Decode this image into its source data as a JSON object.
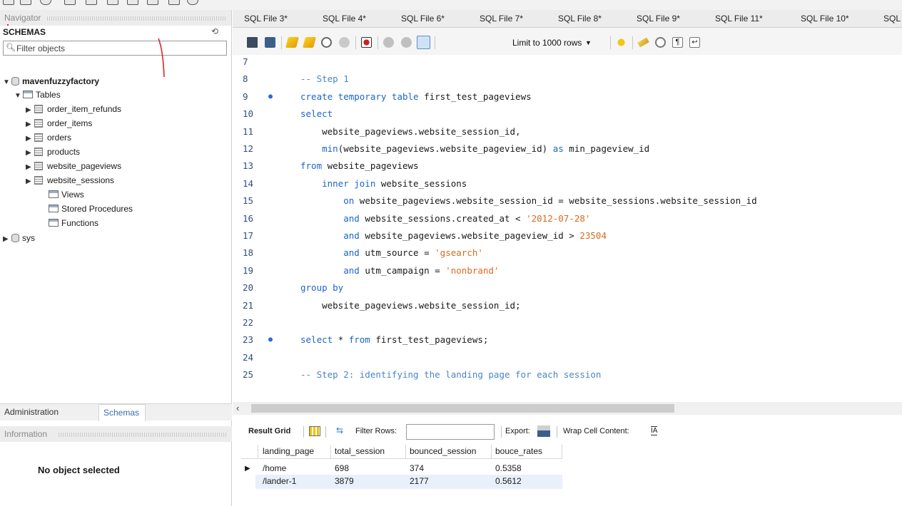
{
  "navigator": {
    "header": "Navigator",
    "schemas_title": "SCHEMAS",
    "filter_placeholder": "Filter objects",
    "tree": {
      "db1": "mavenfuzzyfactory",
      "tables_folder": "Tables",
      "tables": [
        "order_item_refunds",
        "order_items",
        "orders",
        "products",
        "website_pageviews",
        "website_sessions"
      ],
      "views": "Views",
      "stored_procedures": "Stored Procedures",
      "functions": "Functions",
      "db2": "sys"
    },
    "bottom_tabs": {
      "administration": "Administration",
      "schemas": "Schemas"
    },
    "information_header": "Information",
    "no_object": "No object selected"
  },
  "editor": {
    "tabs": [
      "SQL File 3*",
      "SQL File 4*",
      "SQL File 6*",
      "SQL File 7*",
      "SQL File 8*",
      "SQL File 9*",
      "SQL File 11*",
      "SQL File 10*",
      "SQL"
    ],
    "limit_select": "Limit to 1000 rows",
    "code_lines": [
      {
        "n": "7",
        "bp": "",
        "parts": []
      },
      {
        "n": "8",
        "bp": "",
        "parts": [
          {
            "t": "-- Step 1",
            "c": "cmt"
          }
        ]
      },
      {
        "n": "9",
        "bp": "●",
        "parts": [
          {
            "t": "create temporary table",
            "c": "kw"
          },
          {
            "t": " first_test_pageviews",
            "c": ""
          }
        ]
      },
      {
        "n": "10",
        "bp": "",
        "parts": [
          {
            "t": "select",
            "c": "kw"
          }
        ]
      },
      {
        "n": "11",
        "bp": "",
        "parts": [
          {
            "t": "    website_pageviews.website_session_id,",
            "c": ""
          }
        ]
      },
      {
        "n": "12",
        "bp": "",
        "parts": [
          {
            "t": "    min",
            "c": "kw"
          },
          {
            "t": "(website_pageviews.website_pageview_id) ",
            "c": ""
          },
          {
            "t": "as",
            "c": "kw"
          },
          {
            "t": " min_pageview_id",
            "c": ""
          }
        ]
      },
      {
        "n": "13",
        "bp": "",
        "parts": [
          {
            "t": "from",
            "c": "kw"
          },
          {
            "t": " website_pageviews",
            "c": ""
          }
        ]
      },
      {
        "n": "14",
        "bp": "",
        "parts": [
          {
            "t": "    inner join",
            "c": "kw"
          },
          {
            "t": " website_sessions",
            "c": ""
          }
        ]
      },
      {
        "n": "15",
        "bp": "",
        "parts": [
          {
            "t": "        on",
            "c": "kw"
          },
          {
            "t": " website_pageviews.website_session_id = website_sessions.website_session_id",
            "c": ""
          }
        ]
      },
      {
        "n": "16",
        "bp": "",
        "parts": [
          {
            "t": "        and",
            "c": "kw"
          },
          {
            "t": " website_sessions.created_at < ",
            "c": ""
          },
          {
            "t": "'2012-07-28'",
            "c": "str"
          }
        ]
      },
      {
        "n": "17",
        "bp": "",
        "parts": [
          {
            "t": "        and",
            "c": "kw"
          },
          {
            "t": " website_pageviews.website_pageview_id > ",
            "c": ""
          },
          {
            "t": "23504",
            "c": "num"
          }
        ]
      },
      {
        "n": "18",
        "bp": "",
        "parts": [
          {
            "t": "        and",
            "c": "kw"
          },
          {
            "t": " utm_source = ",
            "c": ""
          },
          {
            "t": "'gsearch'",
            "c": "str"
          }
        ]
      },
      {
        "n": "19",
        "bp": "",
        "parts": [
          {
            "t": "        and",
            "c": "kw"
          },
          {
            "t": " utm_campaign = ",
            "c": ""
          },
          {
            "t": "'nonbrand'",
            "c": "str"
          }
        ]
      },
      {
        "n": "20",
        "bp": "",
        "parts": [
          {
            "t": "group by",
            "c": "kw"
          }
        ]
      },
      {
        "n": "21",
        "bp": "",
        "parts": [
          {
            "t": "    website_pageviews.website_session_id;",
            "c": ""
          }
        ]
      },
      {
        "n": "22",
        "bp": "",
        "parts": []
      },
      {
        "n": "23",
        "bp": "●",
        "parts": [
          {
            "t": "select",
            "c": "kw"
          },
          {
            "t": " * ",
            "c": ""
          },
          {
            "t": "from",
            "c": "kw"
          },
          {
            "t": " first_test_pageviews;",
            "c": ""
          }
        ]
      },
      {
        "n": "24",
        "bp": "",
        "parts": []
      },
      {
        "n": "25",
        "bp": "",
        "parts": [
          {
            "t": "-- Step 2: identifying the landing page for each session",
            "c": "cmt"
          }
        ]
      }
    ]
  },
  "results": {
    "result_grid": "Result Grid",
    "filter_rows": "Filter Rows:",
    "export": "Export:",
    "wrap_cell": "Wrap Cell Content:",
    "columns": [
      "landing_page",
      "total_session",
      "bounced_session",
      "bouce_rates"
    ],
    "rows": [
      [
        "/home",
        "698",
        "374",
        "0.5358"
      ],
      [
        "/lander-1",
        "3879",
        "2177",
        "0.5612"
      ]
    ]
  }
}
